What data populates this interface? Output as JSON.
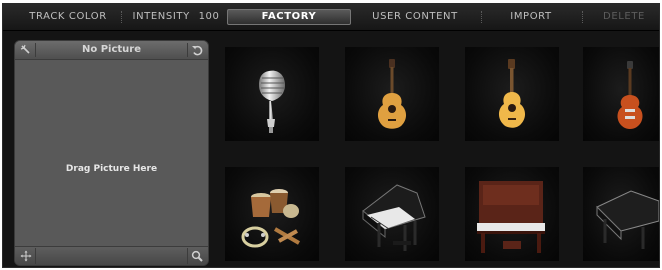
{
  "toolbar": {
    "track_color": "TRACK COLOR",
    "intensity_label": "INTENSITY",
    "intensity_value": "100",
    "factory": "FACTORY",
    "user_content": "USER CONTENT",
    "import": "IMPORT",
    "delete": "DELETE"
  },
  "panel": {
    "title": "No Picture",
    "drag_hint": "Drag Picture Here"
  },
  "thumbnails": [
    {
      "icon": "microphone-icon"
    },
    {
      "icon": "acoustic-guitar-icon"
    },
    {
      "icon": "classical-guitar-icon"
    },
    {
      "icon": "electric-guitar-icon"
    },
    {
      "icon": "percussion-icon"
    },
    {
      "icon": "grand-piano-icon"
    },
    {
      "icon": "upright-piano-icon"
    },
    {
      "icon": "grand-piano-closed-icon"
    }
  ],
  "colors": {
    "background": "#141414",
    "panel": "#595959",
    "active_tab": "#4a4a4a"
  }
}
